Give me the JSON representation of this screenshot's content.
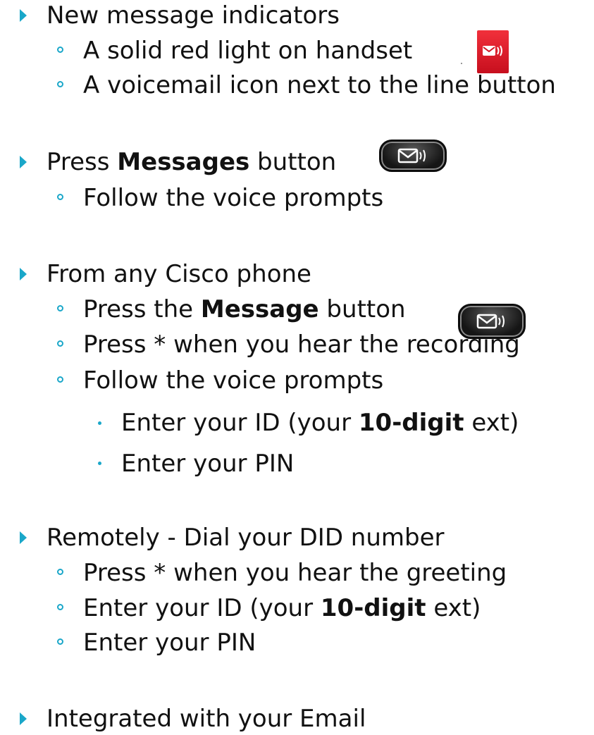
{
  "items": [
    {
      "level": 1,
      "text": "New message indicators"
    },
    {
      "level": 2,
      "text": "A solid red light on handset"
    },
    {
      "level": 2,
      "text": "A voicemail icon next to the line button"
    },
    {
      "level": 1,
      "prefix": "Press ",
      "bold": "Messages",
      "suffix": " button"
    },
    {
      "level": 2,
      "text": "Follow the voice prompts"
    },
    {
      "level": 1,
      "text": "From any Cisco phone"
    },
    {
      "level": 2,
      "prefix": "Press the ",
      "bold": "Message",
      "suffix": " button"
    },
    {
      "level": 2,
      "text": "Press * when you hear the recording"
    },
    {
      "level": 2,
      "text": "Follow the voice prompts"
    },
    {
      "level": 3,
      "prefix": "Enter your ID (your ",
      "bold": "10-digit",
      "suffix": " ext)"
    },
    {
      "level": 3,
      "text": "Enter your PIN"
    },
    {
      "level": 1,
      "text": "Remotely - Dial your DID number"
    },
    {
      "level": 2,
      "text": "Press * when you hear the greeting"
    },
    {
      "level": 2,
      "prefix": "Enter your ID (your ",
      "bold": "10-digit",
      "suffix": " ext)"
    },
    {
      "level": 2,
      "text": "Enter your PIN"
    },
    {
      "level": 1,
      "text": "Integrated with your Email"
    }
  ],
  "icons": {
    "handset_light": "voicemail-red-light-icon",
    "messages_button": "messages-button-icon"
  },
  "colors": {
    "bullet": "#1aa7c9",
    "text": "#111111",
    "handset_light": "#e2202d"
  }
}
